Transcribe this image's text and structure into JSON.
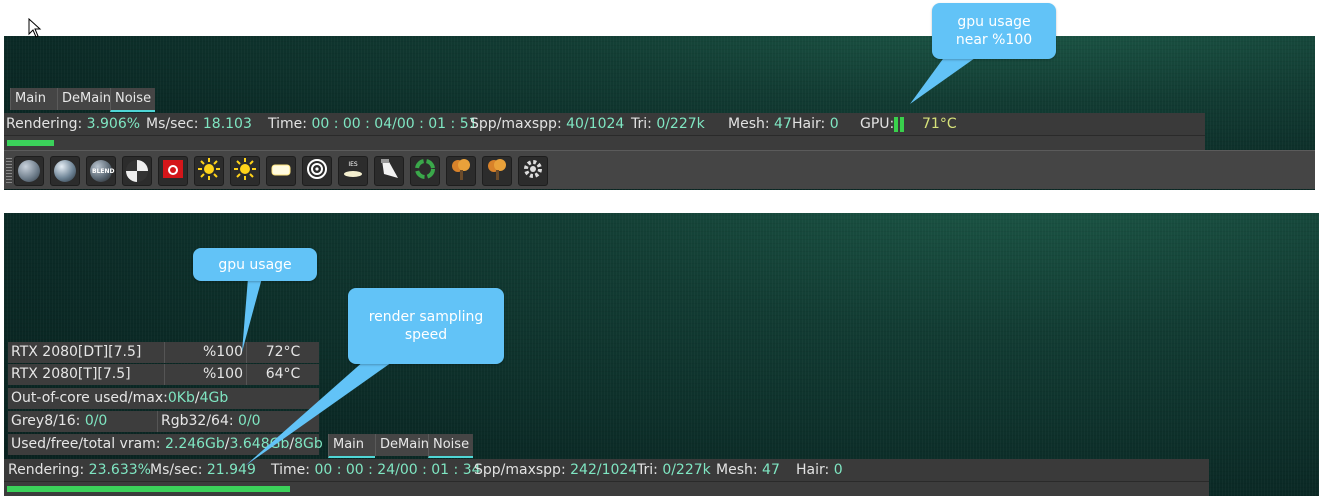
{
  "top_view": {
    "tabs": [
      "Main",
      "DeMain",
      "Noise"
    ],
    "status": {
      "rendering_label": "Rendering:",
      "rendering_value": "3.906%",
      "ms_label": "Ms/sec:",
      "ms_value": "18.103",
      "time_label": "Time:",
      "time_value": "00 : 00 : 04/00 : 01 : 51",
      "spp_label": "Spp/maxspp:",
      "spp_value": "40/1024",
      "tri_label": "Tri:",
      "tri_value": "0/227k",
      "mesh_label": "Mesh:",
      "mesh_value": "47",
      "hair_label": "Hair:",
      "hair_value": "0",
      "gpu_label": "GPU:",
      "gpu_temp": "71°C"
    },
    "progress": 0.039,
    "toolbar": {
      "buttons": [
        {
          "name": "diffuse-material-icon",
          "label": ""
        },
        {
          "name": "glossy-material-icon",
          "label": ""
        },
        {
          "name": "blend-material-icon",
          "label": "BLEND"
        },
        {
          "name": "toon-material-icon",
          "label": ""
        },
        {
          "name": "camera-icon",
          "label": ""
        },
        {
          "name": "sun-light-icon",
          "label": ""
        },
        {
          "name": "sun-light-2-icon",
          "label": ""
        },
        {
          "name": "area-light-icon",
          "label": ""
        },
        {
          "name": "target-light-icon",
          "label": ""
        },
        {
          "name": "ies-light-icon",
          "label": "IES"
        },
        {
          "name": "spot-light-icon",
          "label": ""
        },
        {
          "name": "recycle-icon",
          "label": ""
        },
        {
          "name": "tree-icon",
          "label": ""
        },
        {
          "name": "tree-2-icon",
          "label": ""
        },
        {
          "name": "gear-icon",
          "label": ""
        }
      ]
    }
  },
  "bottom_view": {
    "tabs": [
      "Main",
      "DeMain",
      "Noise"
    ],
    "gpus": [
      {
        "name": "RTX 2080[DT][7.5]",
        "usage": "%100",
        "temp": "72°C"
      },
      {
        "name": "RTX 2080[T][7.5]",
        "usage": "%100",
        "temp": "64°C"
      }
    ],
    "out_of_core": {
      "label": "Out-of-core used/max:",
      "used": "0Kb",
      "sep": "/",
      "max": "4Gb"
    },
    "grey": {
      "label": "Grey8/16:",
      "value": "0/0"
    },
    "rgb": {
      "label": "Rgb32/64:",
      "value": "0/0"
    },
    "vram": {
      "label": "Used/free/total vram:",
      "used": "2.246Gb",
      "free": "3.648Gb",
      "total": "8Gb"
    },
    "status": {
      "rendering_label": "Rendering:",
      "rendering_value": "23.633%",
      "ms_label": "Ms/sec:",
      "ms_value": "21.949",
      "time_label": "Time:",
      "time_value": "00 : 00 : 24/00 : 01 : 34",
      "spp_label": "Spp/maxspp:",
      "spp_value": "242/1024",
      "tri_label": "Tri:",
      "tri_value": "0/227k",
      "mesh_label": "Mesh:",
      "mesh_value": "47",
      "hair_label": "Hair:",
      "hair_value": "0"
    },
    "progress": 0.236
  },
  "callouts": {
    "gpu_near": "gpu usage\nnear %100",
    "gpu_usage": "gpu usage",
    "sampling": "render sampling\nspeed"
  },
  "colors": {
    "accent_value": "#7fe6c2",
    "progress": "#3bd15a",
    "callout": "#62c3f7"
  }
}
